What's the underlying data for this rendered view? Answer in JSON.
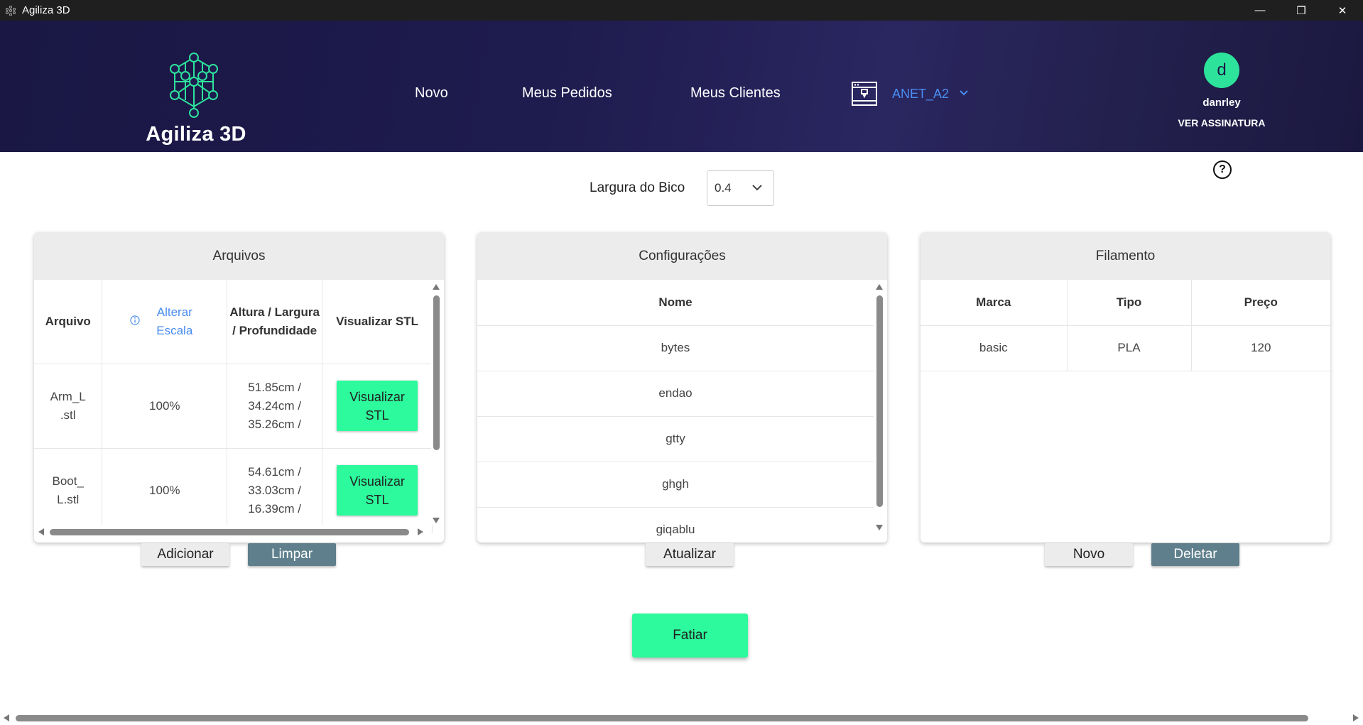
{
  "window": {
    "title": "Agiliza 3D",
    "minimize": "—",
    "maximize": "❐",
    "close": "✕"
  },
  "header": {
    "logo_text": "Agiliza 3D",
    "nav": [
      "Novo",
      "Meus Pedidos",
      "Meus Clientes"
    ],
    "printer": "ANET_A2",
    "user": {
      "initial": "d",
      "name": "danrley",
      "subscription": "VER ASSINATURA"
    }
  },
  "help": "?",
  "nozzle": {
    "label": "Largura do Bico",
    "value": "0.4"
  },
  "files_panel": {
    "title": "Arquivos",
    "columns": {
      "file": "Arquivo",
      "scale": "Alterar Escala",
      "dims": "Altura / Largura / Profundidade",
      "view": "Visualizar STL"
    },
    "rows": [
      {
        "file": "Arm_L .stl",
        "scale": "100%",
        "dims": "51.85cm / 34.24cm / 35.26cm /",
        "button": "Visualizar STL"
      },
      {
        "file": "Boot_ L.stl",
        "scale": "100%",
        "dims": "54.61cm / 33.03cm / 16.39cm /",
        "button": "Visualizar STL"
      }
    ],
    "add_button": "Adicionar",
    "clear_button": "Limpar"
  },
  "config_panel": {
    "title": "Configurações",
    "column": "Nome",
    "rows": [
      "bytes",
      "endao",
      "gtty",
      "ghgh",
      "giqablu"
    ],
    "update_button": "Atualizar"
  },
  "filament_panel": {
    "title": "Filamento",
    "columns": [
      "Marca",
      "Tipo",
      "Preço"
    ],
    "rows": [
      {
        "brand": "basic",
        "type": "PLA",
        "price": "120"
      }
    ],
    "new_button": "Novo",
    "delete_button": "Deletar"
  },
  "slice_button": "Fatiar",
  "colors": {
    "header_bg": "#1e1b4e",
    "accent_green": "#2cfa9c",
    "link_blue": "#4a8df0",
    "button_dark": "#5f7f8c"
  }
}
